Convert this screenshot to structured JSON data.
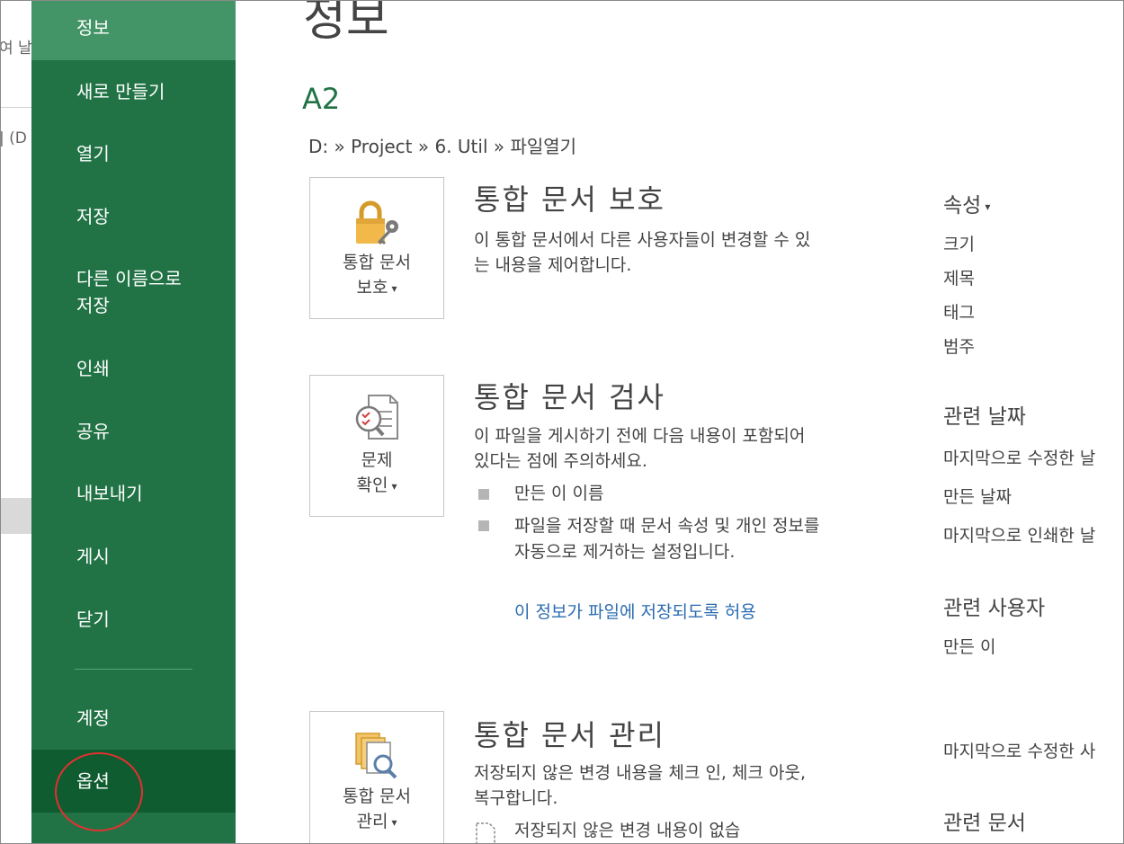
{
  "underlying_window": {
    "fragment_top": "여 날",
    "fragment_mid": "| (D"
  },
  "nav": {
    "items": [
      {
        "label": "정보"
      },
      {
        "label": "새로 만들기"
      },
      {
        "label": "열기"
      },
      {
        "label": "저장"
      },
      {
        "label": "다른 이름으로\n저장"
      },
      {
        "label": "인쇄"
      },
      {
        "label": "공유"
      },
      {
        "label": "내보내기"
      },
      {
        "label": "게시"
      },
      {
        "label": "닫기"
      },
      {
        "label": "계정"
      },
      {
        "label": "옵션"
      }
    ]
  },
  "main": {
    "page_title": "정보",
    "file_name": "A2",
    "file_path": "D: » Project » 6. Util » 파일열기",
    "sections": [
      {
        "button_label_1": "통합 문서",
        "button_label_2": "보호",
        "title": "통합 문서 보호",
        "description": "이 통합 문서에서 다른 사용자들이 변경할 수 있는 내용을 제어합니다."
      },
      {
        "button_label_1": "문제",
        "button_label_2": "확인",
        "title": "통합 문서 검사",
        "description": "이 파일을 게시하기 전에 다음 내용이 포함되어 있다는 점에 주의하세요.",
        "bullets": [
          "만든 이 이름",
          "파일을 저장할 때 문서 속성 및 개인 정보를 자동으로 제거하는 설정입니다."
        ],
        "link": "이 정보가 파일에 저장되도록 허용"
      },
      {
        "button_label_1": "통합 문서",
        "button_label_2": "관리",
        "title": "통합 문서 관리",
        "description": "저장되지 않은 변경 내용을 체크 인, 체크 아웃, 복구합니다.",
        "note": "저장되지 않은 변경 내용이 없습"
      }
    ]
  },
  "properties": {
    "heading": "속성",
    "items": [
      "크기",
      "제목",
      "태그",
      "범주"
    ],
    "dates_heading": "관련 날짜",
    "dates": [
      "마지막으로 수정한 날",
      "만든 날짜",
      "마지막으로 인쇄한 날"
    ],
    "people_heading": "관련 사용자",
    "people": [
      "만든 이"
    ],
    "last_modified_by": "마지막으로 수정한 사",
    "docs_heading": "관련 문서"
  },
  "colors": {
    "nav_bg": "#217346",
    "nav_active": "#439467",
    "nav_hover": "#0e5c2f",
    "accent_green": "#217346",
    "link_blue": "#2b6cb0",
    "annotation_red": "#e53030"
  }
}
